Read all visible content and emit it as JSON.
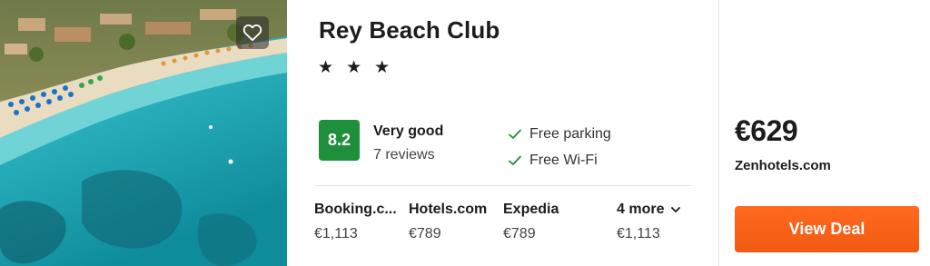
{
  "hotel": {
    "name": "Rey Beach Club",
    "stars": "★ ★ ★",
    "rating_score": "8.2",
    "rating_label": "Very good",
    "reviews": "7 reviews",
    "amenities": [
      "Free parking",
      "Free Wi-Fi"
    ]
  },
  "providers": [
    {
      "name": "Booking.c...",
      "price": "€1,113"
    },
    {
      "name": "Hotels.com",
      "price": "€789"
    },
    {
      "name": "Expedia",
      "price": "€789"
    },
    {
      "name": "4 more",
      "price": "€1,113"
    }
  ],
  "deal": {
    "price": "€629",
    "site": "Zenhotels.com",
    "button_label": "View Deal"
  },
  "colors": {
    "rating_green": "#1e8f3b",
    "deal_orange": "#f15a12",
    "check_green": "#1e8f3b"
  },
  "icons": {
    "favorite": "heart-outline-icon",
    "amenity": "check-icon",
    "more": "chevron-down-icon"
  }
}
